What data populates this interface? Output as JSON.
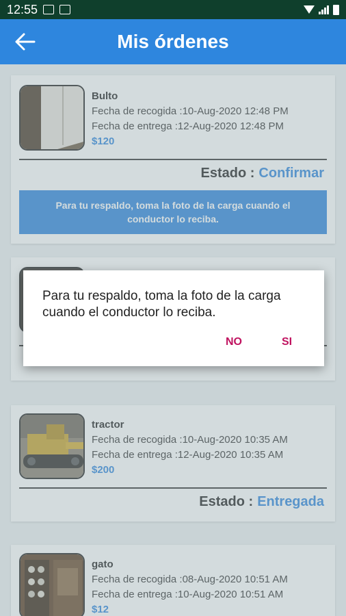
{
  "status_bar": {
    "time": "12:55"
  },
  "app_bar": {
    "title": "Mis órdenes"
  },
  "orders": [
    {
      "name": "Bulto",
      "pickup": "Fecha de recogida :10-Aug-2020 12:48 PM",
      "delivery": "Fecha de entrega :12-Aug-2020 12:48 PM",
      "price": "$120",
      "estado_label": "Estado :",
      "estado_value": "Confirmar",
      "banner": "Para tu respaldo, toma la foto de la carga cuando el conductor lo reciba."
    },
    {
      "name": "tractor",
      "pickup": "Fecha de recogida :10-Aug-2020 10:35 AM",
      "delivery": "Fecha de entrega :12-Aug-2020 10:35 AM",
      "price": "$200",
      "estado_label": "Estado :",
      "estado_value": "Entregada"
    },
    {
      "name": "gato",
      "pickup": "Fecha de recogida :08-Aug-2020 10:51 AM",
      "delivery": "Fecha de entrega :10-Aug-2020 10:51 AM",
      "price": "$12"
    }
  ],
  "dialog": {
    "message": "Para tu respaldo, toma la foto de la carga cuando el conductor lo reciba.",
    "no_label": "NO",
    "si_label": "SI"
  },
  "colors": {
    "accent": "#2e86de",
    "status_bar": "#0f3f2c",
    "dialog_button": "#c0125f"
  }
}
